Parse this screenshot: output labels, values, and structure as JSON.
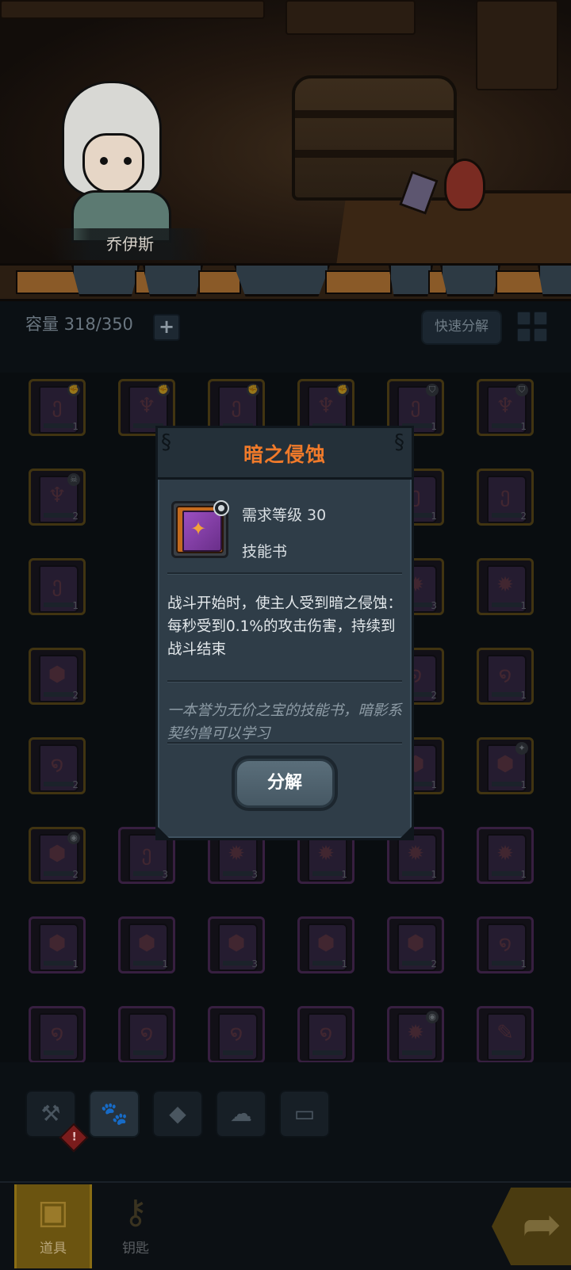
{
  "hero": {
    "name": "乔伊斯"
  },
  "inventory": {
    "capacity_label": "容量 318/350",
    "expand_glyph": "+",
    "quick_decompose_label": "快速分解",
    "slots": [
      {
        "row": 0,
        "col": 0,
        "count": "1",
        "badge": "fist",
        "border": "gold",
        "symbol": "ე"
      },
      {
        "row": 0,
        "col": 1,
        "count": "",
        "badge": "fist",
        "border": "gold",
        "symbol": "♆"
      },
      {
        "row": 0,
        "col": 2,
        "count": "",
        "badge": "fist",
        "border": "gold",
        "symbol": "ე"
      },
      {
        "row": 0,
        "col": 3,
        "count": "",
        "badge": "fist",
        "border": "gold",
        "symbol": "♆"
      },
      {
        "row": 0,
        "col": 4,
        "count": "1",
        "badge": "shield",
        "border": "gold",
        "symbol": "ე"
      },
      {
        "row": 0,
        "col": 5,
        "count": "1",
        "badge": "shield",
        "border": "gold",
        "symbol": "♆"
      },
      {
        "row": 1,
        "col": 0,
        "count": "2",
        "badge": "skull",
        "border": "gold",
        "symbol": "♆"
      },
      {
        "row": 1,
        "col": 4,
        "count": "1",
        "badge": "",
        "border": "gold",
        "symbol": "ე"
      },
      {
        "row": 1,
        "col": 5,
        "count": "2",
        "badge": "",
        "border": "gold",
        "symbol": "ე"
      },
      {
        "row": 2,
        "col": 0,
        "count": "1",
        "badge": "",
        "border": "gold",
        "symbol": "ე"
      },
      {
        "row": 2,
        "col": 4,
        "count": "3",
        "badge": "",
        "border": "gold",
        "symbol": "✹"
      },
      {
        "row": 2,
        "col": 5,
        "count": "1",
        "badge": "",
        "border": "gold",
        "symbol": "✹"
      },
      {
        "row": 3,
        "col": 0,
        "count": "2",
        "badge": "",
        "border": "gold",
        "symbol": "⬢"
      },
      {
        "row": 3,
        "col": 4,
        "count": "2",
        "badge": "",
        "border": "gold",
        "symbol": "໑"
      },
      {
        "row": 3,
        "col": 5,
        "count": "1",
        "badge": "",
        "border": "gold",
        "symbol": "໑"
      },
      {
        "row": 4,
        "col": 0,
        "count": "2",
        "badge": "",
        "border": "gold",
        "symbol": "໑"
      },
      {
        "row": 4,
        "col": 4,
        "count": "1",
        "badge": "",
        "border": "gold",
        "symbol": "⬢"
      },
      {
        "row": 4,
        "col": 5,
        "count": "1",
        "badge": "sparkle",
        "border": "gold",
        "symbol": "⬢"
      },
      {
        "row": 5,
        "col": 0,
        "count": "2",
        "badge": "eye",
        "border": "gold",
        "symbol": "⬢"
      },
      {
        "row": 5,
        "col": 1,
        "count": "3",
        "badge": "",
        "border": "purple",
        "symbol": "ე"
      },
      {
        "row": 5,
        "col": 2,
        "count": "3",
        "badge": "",
        "border": "purple",
        "symbol": "✹"
      },
      {
        "row": 5,
        "col": 3,
        "count": "1",
        "badge": "",
        "border": "purple",
        "symbol": "✹"
      },
      {
        "row": 5,
        "col": 4,
        "count": "1",
        "badge": "",
        "border": "purple",
        "symbol": "✹"
      },
      {
        "row": 5,
        "col": 5,
        "count": "1",
        "badge": "",
        "border": "purple",
        "symbol": "✹"
      },
      {
        "row": 6,
        "col": 0,
        "count": "1",
        "badge": "",
        "border": "purple",
        "symbol": "⬢"
      },
      {
        "row": 6,
        "col": 1,
        "count": "1",
        "badge": "",
        "border": "purple",
        "symbol": "⬢"
      },
      {
        "row": 6,
        "col": 2,
        "count": "3",
        "badge": "",
        "border": "purple",
        "symbol": "⬢"
      },
      {
        "row": 6,
        "col": 3,
        "count": "1",
        "badge": "",
        "border": "purple",
        "symbol": "⬢"
      },
      {
        "row": 6,
        "col": 4,
        "count": "2",
        "badge": "",
        "border": "purple",
        "symbol": "⬢"
      },
      {
        "row": 6,
        "col": 5,
        "count": "1",
        "badge": "",
        "border": "purple",
        "symbol": "໑"
      },
      {
        "row": 7,
        "col": 0,
        "count": "",
        "badge": "",
        "border": "purple",
        "symbol": "໑"
      },
      {
        "row": 7,
        "col": 1,
        "count": "",
        "badge": "",
        "border": "purple",
        "symbol": "໑"
      },
      {
        "row": 7,
        "col": 2,
        "count": "",
        "badge": "",
        "border": "purple",
        "symbol": "໑"
      },
      {
        "row": 7,
        "col": 3,
        "count": "",
        "badge": "",
        "border": "purple",
        "symbol": "໑"
      },
      {
        "row": 7,
        "col": 4,
        "count": "",
        "badge": "eye",
        "border": "purple",
        "symbol": "✹"
      },
      {
        "row": 7,
        "col": 5,
        "count": "",
        "badge": "",
        "border": "purple",
        "symbol": "✎"
      }
    ]
  },
  "categories": [
    {
      "name": "tools",
      "glyph": "⚒",
      "active": false
    },
    {
      "name": "pets",
      "glyph": "🐾",
      "active": true
    },
    {
      "name": "gems",
      "glyph": "◆",
      "active": false
    },
    {
      "name": "materials",
      "glyph": "☁",
      "active": false
    },
    {
      "name": "chests",
      "glyph": "▭",
      "active": false
    }
  ],
  "alert_badge": "!",
  "bottom_nav": {
    "items_label": "道具",
    "keys_label": "钥匙",
    "share_glyph": "➦"
  },
  "modal": {
    "title": "暗之侵蚀",
    "required_level": "需求等级 30",
    "item_type": "技能书",
    "description": "战斗开始时，使主人受到暗之侵蚀：每秒受到0.1%的攻击伤害，持续到战斗结束",
    "flavor_text": "一本誉为无价之宝的技能书，暗影系契约兽可以学习",
    "decompose_label": "分解"
  },
  "colors": {
    "title_orange": "#f07a2a",
    "panel_bg": "#2f3d48",
    "slot_gold": "#6b5416",
    "slot_purple": "#5a2f66",
    "nav_active": "#6b5410"
  }
}
